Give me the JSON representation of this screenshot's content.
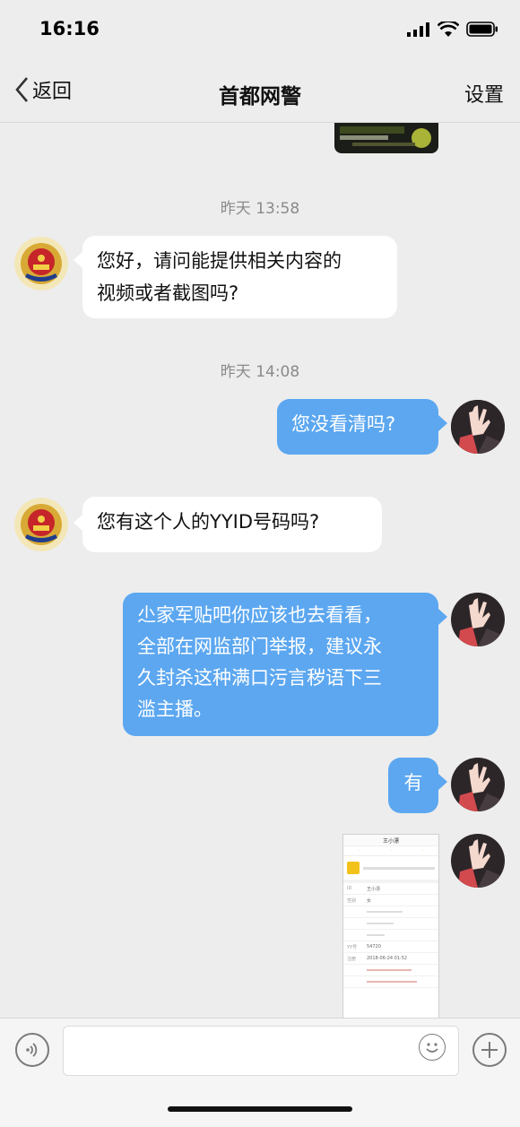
{
  "status_bar": {
    "time": "16:16"
  },
  "nav": {
    "back_label": "返回",
    "title": "首都网警",
    "settings_label": "设置"
  },
  "messages": [
    {
      "type": "timestamp",
      "text": "昨天 13:58"
    },
    {
      "type": "incoming",
      "lines": [
        "您好，请问能提供相关内容的",
        "视频或者截图吗?"
      ]
    },
    {
      "type": "timestamp",
      "text": "昨天 14:08"
    },
    {
      "type": "outgoing",
      "lines": [
        "您没看清吗?"
      ]
    },
    {
      "type": "incoming",
      "lines": [
        "您有这个人的YYID号码吗?"
      ]
    },
    {
      "type": "outgoing",
      "lines": [
        "尐家军贴吧你应该也去看看，",
        "全部在网监部门举报，建议永",
        "久封杀这种满口污言秽语下三",
        "滥主播。"
      ]
    },
    {
      "type": "outgoing",
      "lines": [
        "有"
      ]
    },
    {
      "type": "outgoing-image",
      "thumb_title": "王小漂",
      "rows": [
        {
          "k": "ID",
          "v": "王小漂"
        },
        {
          "k": "性别",
          "v": "女"
        },
        {
          "k": "YY号",
          "v": "54720"
        },
        {
          "k": "注册",
          "v": "2018-06-24 01:52"
        }
      ]
    }
  ],
  "colors": {
    "out_bubble": "#5ca7f0",
    "in_bubble": "#ffffff",
    "background": "#ededed"
  }
}
